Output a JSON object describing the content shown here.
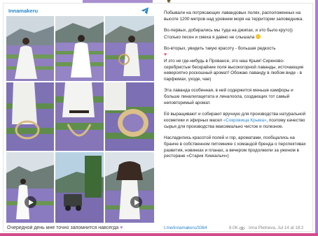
{
  "channel": {
    "name": "Innamakeru"
  },
  "caption": {
    "text": "Очередной день мне точно запомнится навсегда"
  },
  "post": {
    "p1": "Побывали на потрясающих лавандовых полях, расположенных на высоте 1200 метров над уровнем моря на территории заповедника.",
    "p2": "Во-первых, добирались мы туда на джипах, и это было круто)) Столько песен и смеха я давно не слышала",
    "p3_a": "Во-вторых, увидеть такую красоту - большая редкость",
    "p3_b": "И это не где-нибудь в Провансе, это наш Крым! Сиреново-серебристые бескрайние поля высокогорной лаванды, источающие невероятно роскошный аромат! Обожаю лаванду в любом виде - в парфюмах, уходе, чае)",
    "p4": "Эта лаванда особенная, в ней содержится меньше камфоры и больше линалилацетата и линалоола, создающих тот самый неповторимый аромат.",
    "p5_a": "Её выращивают и собирают вручную для производства натуральной косметики и эфирных масел",
    "p5_link": "«Сокровища Крыма»",
    "p5_b": ", поэтому качество сырья для производства максимально чистое и полезное.",
    "p6": "Насладились красотой полей и гор, ароматами, пообщались на бранче в собственном питомнике с командой бренда о перспективах развития, новинках и планах, а вечером продолжили за ужином в ресторане «Старик Хинкалыч»)"
  },
  "footer": {
    "link": "t.me/innamakeru/3364",
    "views": "8.0K",
    "author_date": "Inna Pletneva, Jul 14 at 18:2"
  },
  "colors": {
    "accent": "#2a86cc",
    "lavender": "#8c7ac4"
  },
  "icons": {
    "telegram": "telegram-icon",
    "play": "play-icon",
    "eye": "eye-icon"
  }
}
